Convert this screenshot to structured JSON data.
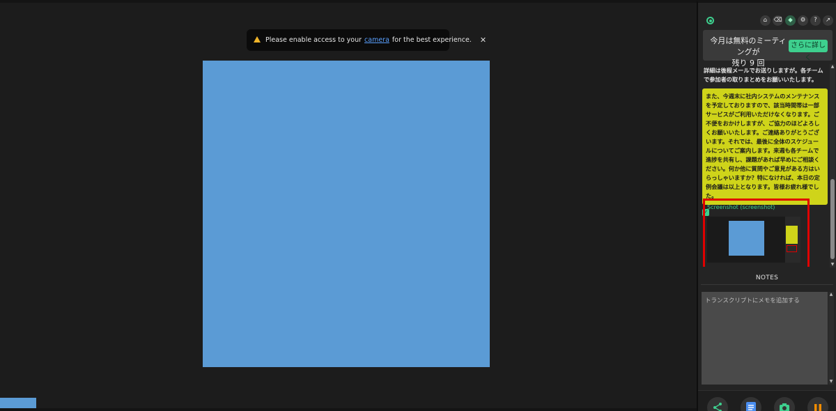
{
  "toast": {
    "prefix": "Please enable access to your",
    "link": "camera",
    "suffix": "for the best experience.",
    "close": "✕"
  },
  "panel": {
    "toolbar_icons": [
      "home-icon",
      "eraser-icon",
      "shield-icon",
      "gear-icon",
      "help-icon",
      "pin-icon"
    ],
    "promo": {
      "line1": "今月は無料のミーティングが",
      "line2": "残り 9 回",
      "button": "さらに詳しく"
    },
    "transcript": {
      "partial_text": "詳細は後程メールでお送りしますが。各チームで参加者の取りまとめをお願いいたします。",
      "highlight": "また、今週末に社内システムのメンテナンスを予定しておりますので、該当時間帯は一部サービスがご利用いただけなくなります。ご不便をおかけしますが、ご協力のほどよろしくお願いいたします。ご連絡ありがとうございます。それでは、最後に全体のスケジュールについてご案内します。来週も各チームで進捗を共有し、課題があれば早めにご相談ください。何か他に質問やご意見がある方はいらっしゃいますか？特になければ、本日の定例会議は以上となります。皆様お疲れ様でした。",
      "screenshot_label": "Screenshot (screenshot)"
    },
    "notes": {
      "title": "NOTES",
      "placeholder": "トランスクリプトにメモを追加する"
    },
    "footer_buttons": [
      "share-icon",
      "document-icon",
      "camera-icon",
      "pause-icon"
    ]
  },
  "colors": {
    "accent": "#3ecf8e",
    "video": "#5b9bd5",
    "highlight": "#cfd41a",
    "selection": "#e00000"
  }
}
